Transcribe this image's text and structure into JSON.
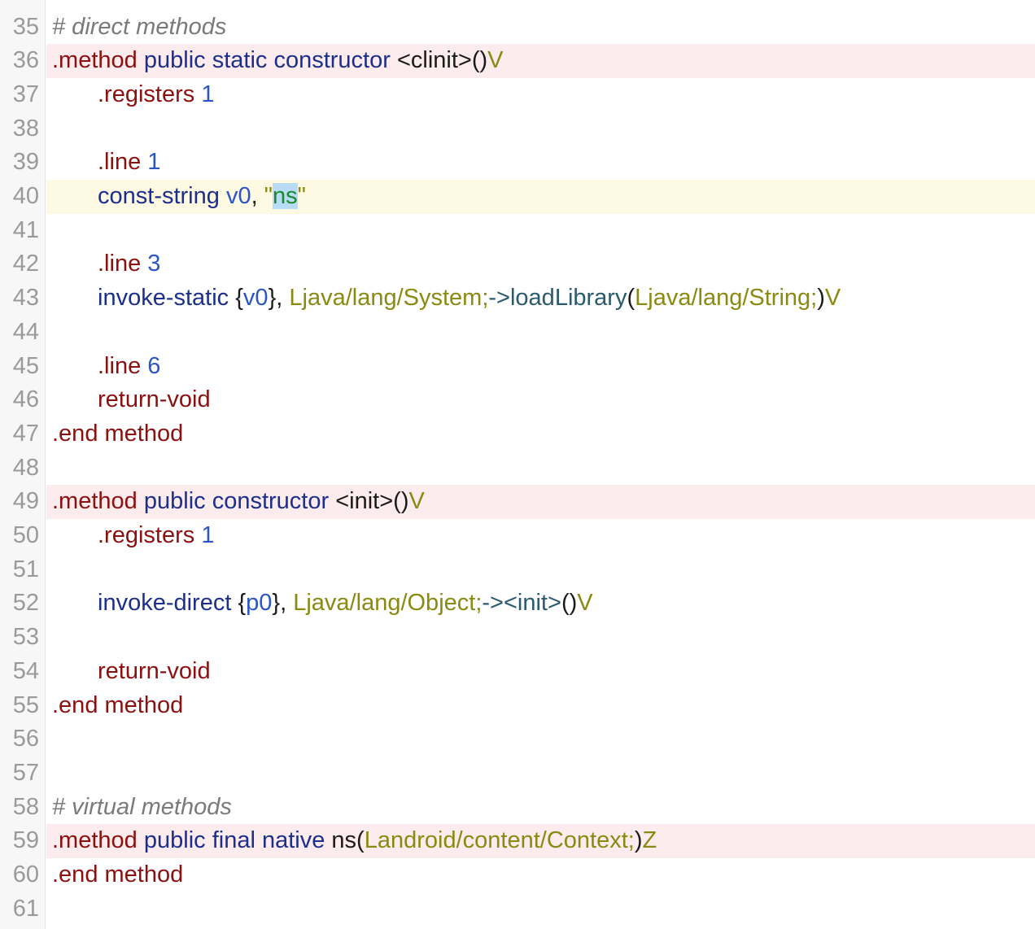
{
  "editor": {
    "lines": [
      {
        "n": "35",
        "hl": "",
        "indent": false,
        "tokens": [
          {
            "c": "comment",
            "t": "# direct methods"
          }
        ]
      },
      {
        "n": "36",
        "hl": "method",
        "indent": false,
        "tokens": [
          {
            "c": "directive",
            "t": ".method"
          },
          {
            "c": "punct",
            "t": " "
          },
          {
            "c": "keyword",
            "t": "public"
          },
          {
            "c": "punct",
            "t": " "
          },
          {
            "c": "keyword",
            "t": "static"
          },
          {
            "c": "punct",
            "t": " "
          },
          {
            "c": "keyword",
            "t": "constructor"
          },
          {
            "c": "punct",
            "t": " "
          },
          {
            "c": "name",
            "t": "<clinit>()"
          },
          {
            "c": "type",
            "t": "V"
          }
        ]
      },
      {
        "n": "37",
        "hl": "",
        "indent": true,
        "tokens": [
          {
            "c": "directive",
            "t": ".registers"
          },
          {
            "c": "punct",
            "t": " "
          },
          {
            "c": "number",
            "t": "1"
          }
        ]
      },
      {
        "n": "38",
        "hl": "",
        "indent": false,
        "tokens": []
      },
      {
        "n": "39",
        "hl": "",
        "indent": true,
        "tokens": [
          {
            "c": "directive",
            "t": ".line"
          },
          {
            "c": "punct",
            "t": " "
          },
          {
            "c": "number",
            "t": "1"
          }
        ]
      },
      {
        "n": "40",
        "hl": "current",
        "indent": true,
        "tokens": [
          {
            "c": "keyword",
            "t": "const-string"
          },
          {
            "c": "punct",
            "t": " "
          },
          {
            "c": "reg",
            "t": "v0"
          },
          {
            "c": "punct",
            "t": ", "
          },
          {
            "c": "string-q",
            "t": "\""
          },
          {
            "c": "string",
            "t": "ns"
          },
          {
            "c": "string-q",
            "t": "\""
          }
        ]
      },
      {
        "n": "41",
        "hl": "",
        "indent": false,
        "tokens": []
      },
      {
        "n": "42",
        "hl": "",
        "indent": true,
        "tokens": [
          {
            "c": "directive",
            "t": ".line"
          },
          {
            "c": "punct",
            "t": " "
          },
          {
            "c": "number",
            "t": "3"
          }
        ]
      },
      {
        "n": "43",
        "hl": "",
        "indent": true,
        "tokens": [
          {
            "c": "keyword",
            "t": "invoke-static"
          },
          {
            "c": "punct",
            "t": " {"
          },
          {
            "c": "reg",
            "t": "v0"
          },
          {
            "c": "punct",
            "t": "}, "
          },
          {
            "c": "type",
            "t": "Ljava/lang/System;"
          },
          {
            "c": "op",
            "t": "->"
          },
          {
            "c": "member",
            "t": "loadLibrary"
          },
          {
            "c": "punct",
            "t": "("
          },
          {
            "c": "type",
            "t": "Ljava/lang/String;"
          },
          {
            "c": "punct",
            "t": ")"
          },
          {
            "c": "type",
            "t": "V"
          }
        ]
      },
      {
        "n": "44",
        "hl": "",
        "indent": false,
        "tokens": []
      },
      {
        "n": "45",
        "hl": "",
        "indent": true,
        "tokens": [
          {
            "c": "directive",
            "t": ".line"
          },
          {
            "c": "punct",
            "t": " "
          },
          {
            "c": "number",
            "t": "6"
          }
        ]
      },
      {
        "n": "46",
        "hl": "",
        "indent": true,
        "tokens": [
          {
            "c": "directive",
            "t": "return-void"
          }
        ]
      },
      {
        "n": "47",
        "hl": "",
        "indent": false,
        "tokens": [
          {
            "c": "directive",
            "t": ".end method"
          }
        ]
      },
      {
        "n": "48",
        "hl": "",
        "indent": false,
        "tokens": []
      },
      {
        "n": "49",
        "hl": "method",
        "indent": false,
        "tokens": [
          {
            "c": "directive",
            "t": ".method"
          },
          {
            "c": "punct",
            "t": " "
          },
          {
            "c": "keyword",
            "t": "public"
          },
          {
            "c": "punct",
            "t": " "
          },
          {
            "c": "keyword",
            "t": "constructor"
          },
          {
            "c": "punct",
            "t": " "
          },
          {
            "c": "name",
            "t": "<init>()"
          },
          {
            "c": "type",
            "t": "V"
          }
        ]
      },
      {
        "n": "50",
        "hl": "",
        "indent": true,
        "tokens": [
          {
            "c": "directive",
            "t": ".registers"
          },
          {
            "c": "punct",
            "t": " "
          },
          {
            "c": "number",
            "t": "1"
          }
        ]
      },
      {
        "n": "51",
        "hl": "",
        "indent": false,
        "tokens": []
      },
      {
        "n": "52",
        "hl": "",
        "indent": true,
        "tokens": [
          {
            "c": "keyword",
            "t": "invoke-direct"
          },
          {
            "c": "punct",
            "t": " {"
          },
          {
            "c": "reg",
            "t": "p0"
          },
          {
            "c": "punct",
            "t": "}, "
          },
          {
            "c": "type",
            "t": "Ljava/lang/Object;"
          },
          {
            "c": "op",
            "t": "->"
          },
          {
            "c": "member",
            "t": "<init>"
          },
          {
            "c": "punct",
            "t": "()"
          },
          {
            "c": "type",
            "t": "V"
          }
        ]
      },
      {
        "n": "53",
        "hl": "",
        "indent": false,
        "tokens": []
      },
      {
        "n": "54",
        "hl": "",
        "indent": true,
        "tokens": [
          {
            "c": "directive",
            "t": "return-void"
          }
        ]
      },
      {
        "n": "55",
        "hl": "",
        "indent": false,
        "tokens": [
          {
            "c": "directive",
            "t": ".end method"
          }
        ]
      },
      {
        "n": "56",
        "hl": "",
        "indent": false,
        "tokens": []
      },
      {
        "n": "57",
        "hl": "",
        "indent": false,
        "tokens": []
      },
      {
        "n": "58",
        "hl": "",
        "indent": false,
        "tokens": [
          {
            "c": "comment",
            "t": "# virtual methods"
          }
        ]
      },
      {
        "n": "59",
        "hl": "method",
        "indent": false,
        "tokens": [
          {
            "c": "directive",
            "t": ".method"
          },
          {
            "c": "punct",
            "t": " "
          },
          {
            "c": "keyword",
            "t": "public"
          },
          {
            "c": "punct",
            "t": " "
          },
          {
            "c": "keyword",
            "t": "final"
          },
          {
            "c": "punct",
            "t": " "
          },
          {
            "c": "keyword",
            "t": "native"
          },
          {
            "c": "punct",
            "t": " "
          },
          {
            "c": "name",
            "t": "ns("
          },
          {
            "c": "type",
            "t": "Landroid/content/Context;"
          },
          {
            "c": "punct",
            "t": ")"
          },
          {
            "c": "type",
            "t": "Z"
          }
        ]
      },
      {
        "n": "60",
        "hl": "",
        "indent": false,
        "tokens": [
          {
            "c": "directive",
            "t": ".end method"
          }
        ]
      },
      {
        "n": "61",
        "hl": "",
        "indent": false,
        "tokens": []
      }
    ]
  }
}
